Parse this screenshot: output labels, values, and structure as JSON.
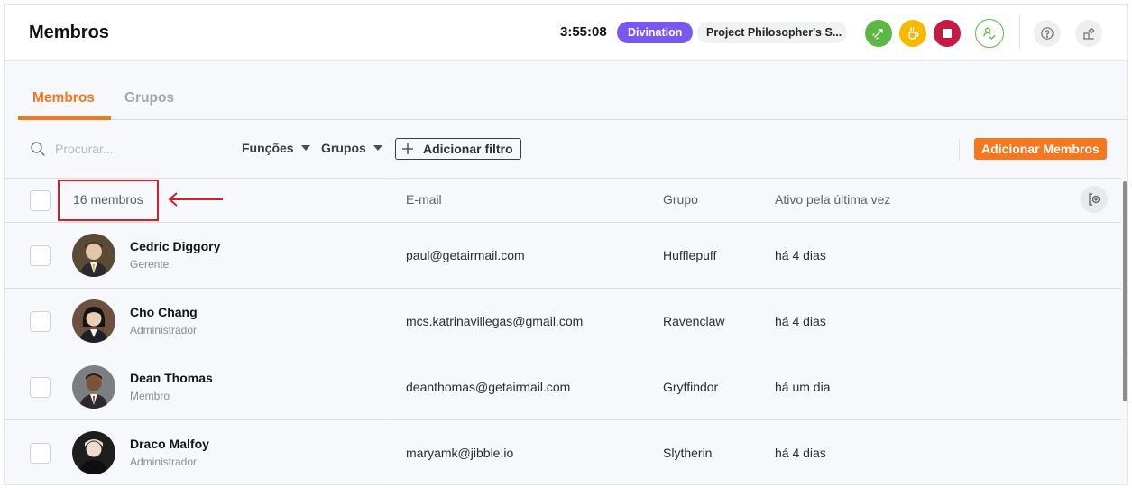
{
  "header": {
    "title": "Membros",
    "timer": "3:55:08",
    "activity": "Divination",
    "project": "Project Philosopher's S...",
    "colors": {
      "switch": "#5cb845",
      "break": "#f5b900",
      "stop": "#c41a44",
      "accent": "#f5781e",
      "activity": "#7b57f0"
    },
    "buttons": {
      "switch_icon": "switch-activity-icon",
      "break_icon": "coffee-icon",
      "stop_icon": "stop-icon",
      "timesheet_icon": "user-check-icon",
      "help_icon": "help-icon",
      "settings_icon": "organization-settings-icon"
    }
  },
  "tabs": [
    {
      "label": "Membros",
      "active": true
    },
    {
      "label": "Grupos",
      "active": false
    }
  ],
  "toolbar": {
    "search_placeholder": "Procurar...",
    "filters": [
      "Funções",
      "Grupos"
    ],
    "add_filter_label": "Adicionar filtro",
    "add_members_label": "Adicionar Membros"
  },
  "table": {
    "count_label": "16 membros",
    "columns": {
      "email": "E-mail",
      "group": "Grupo",
      "active": "Ativo pela última vez"
    },
    "rows": [
      {
        "name": "Cedric Diggory",
        "role": "Gerente",
        "email": "paul@getairmail.com",
        "group": "Hufflepuff",
        "last_active": "há 4 dias",
        "avatar_bg": "#5a4a36"
      },
      {
        "name": "Cho Chang",
        "role": "Administrador",
        "email": "mcs.katrinavillegas@gmail.com",
        "group": "Ravenclaw",
        "last_active": "há 4 dias",
        "avatar_bg": "#6b5240"
      },
      {
        "name": "Dean Thomas",
        "role": "Membro",
        "email": "deanthomas@getairmail.com",
        "group": "Gryffindor",
        "last_active": "há um dia",
        "avatar_bg": "#7d7e82"
      },
      {
        "name": "Draco Malfoy",
        "role": "Administrador",
        "email": "maryamk@jibble.io",
        "group": "Slytherin",
        "last_active": "há 4 dias",
        "avatar_bg": "#1e1e1e"
      }
    ]
  }
}
